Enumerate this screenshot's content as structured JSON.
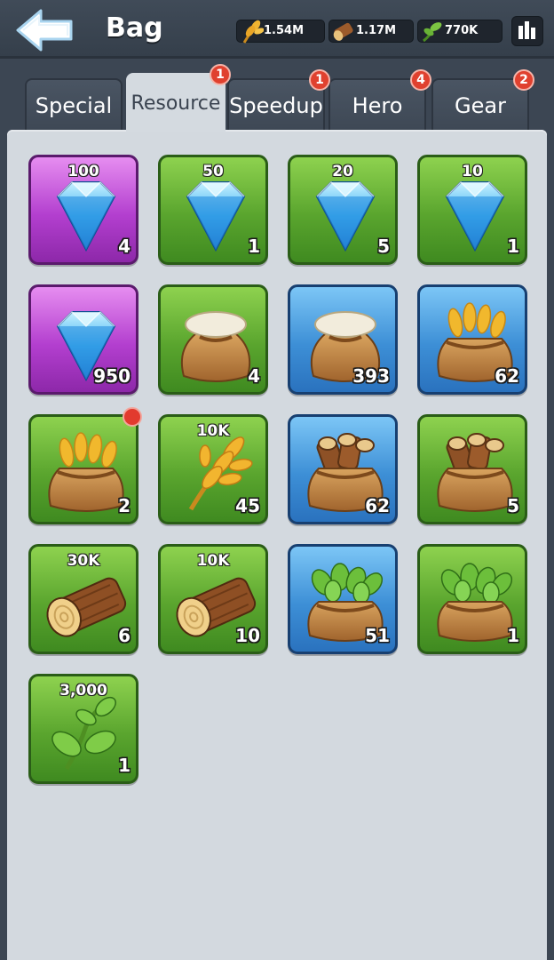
{
  "header": {
    "title": "Bag",
    "resources": [
      {
        "icon": "wheat-icon",
        "value": "1.54M"
      },
      {
        "icon": "wood-log-icon",
        "value": "1.17M"
      },
      {
        "icon": "leaf-icon",
        "value": "770K"
      }
    ],
    "stats_icon": "bar-chart-icon"
  },
  "tabs": [
    {
      "label": "Special",
      "badge": null
    },
    {
      "label": "Resource",
      "badge": "1",
      "active": true
    },
    {
      "label": "Speedup",
      "badge": "1"
    },
    {
      "label": "Hero",
      "badge": "4"
    },
    {
      "label": "Gear",
      "badge": "2"
    }
  ],
  "items": [
    {
      "type": "diamond",
      "rarity": "purple",
      "amount": "100",
      "count": "4"
    },
    {
      "type": "diamond",
      "rarity": "green",
      "amount": "50",
      "count": "1"
    },
    {
      "type": "diamond",
      "rarity": "green",
      "amount": "20",
      "count": "5"
    },
    {
      "type": "diamond",
      "rarity": "green",
      "amount": "10",
      "count": "1"
    },
    {
      "type": "diamond",
      "rarity": "purple",
      "amount": "",
      "count": "950"
    },
    {
      "type": "flour-sack",
      "rarity": "green",
      "amount": "",
      "count": "4"
    },
    {
      "type": "flour-sack",
      "rarity": "blue",
      "amount": "",
      "count": "393"
    },
    {
      "type": "wheat-sack",
      "rarity": "blue",
      "amount": "",
      "count": "62"
    },
    {
      "type": "wheat-sack",
      "rarity": "green",
      "amount": "",
      "count": "2",
      "new": true
    },
    {
      "type": "wheat",
      "rarity": "green",
      "amount": "10K",
      "count": "45"
    },
    {
      "type": "log-sack",
      "rarity": "blue",
      "amount": "",
      "count": "62"
    },
    {
      "type": "log-sack",
      "rarity": "green",
      "amount": "",
      "count": "5"
    },
    {
      "type": "log",
      "rarity": "green",
      "amount": "30K",
      "count": "6"
    },
    {
      "type": "log",
      "rarity": "green",
      "amount": "10K",
      "count": "10"
    },
    {
      "type": "leaf-sack",
      "rarity": "blue",
      "amount": "",
      "count": "51"
    },
    {
      "type": "leaf-sack",
      "rarity": "green",
      "amount": "",
      "count": "1"
    },
    {
      "type": "sprout",
      "rarity": "green",
      "amount": "3,000",
      "count": "1"
    }
  ]
}
